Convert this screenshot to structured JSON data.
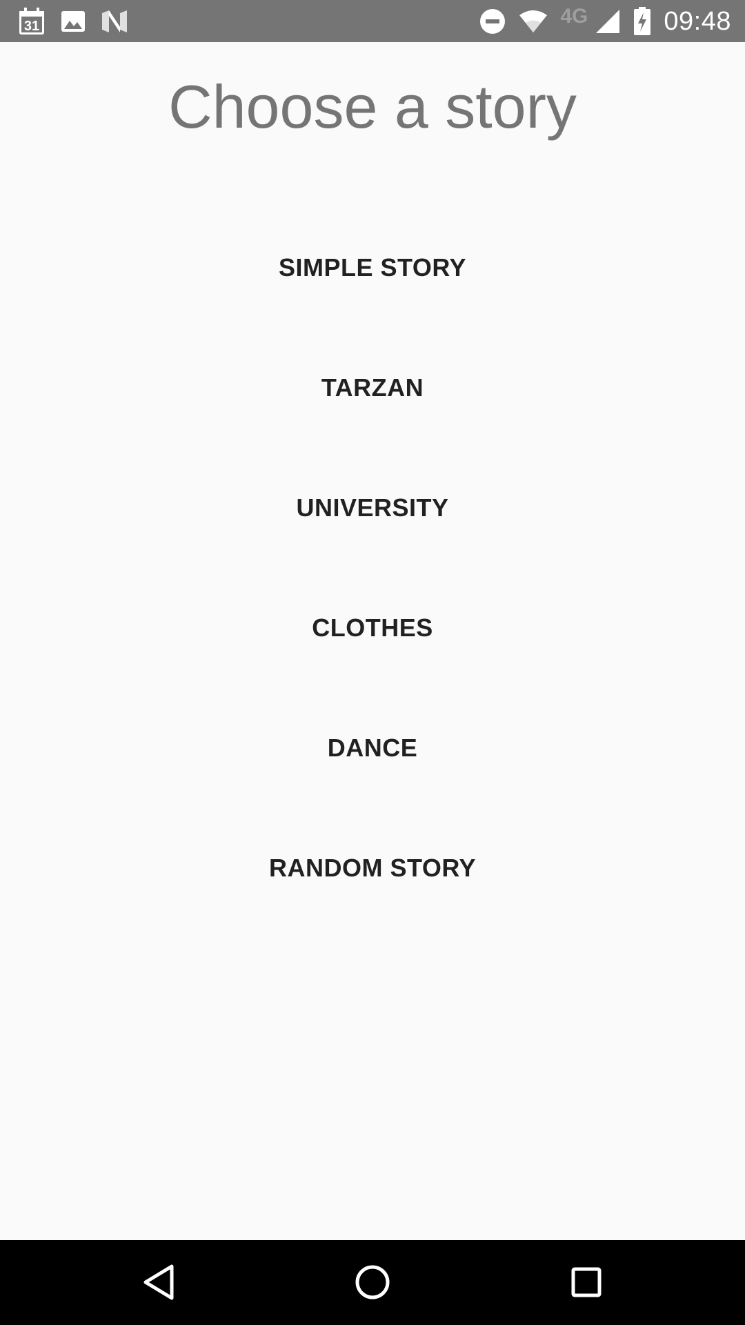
{
  "status_bar": {
    "left_icons": [
      "calendar-icon",
      "image-icon",
      "app-n-icon"
    ],
    "calendar_day": "31",
    "right_icons": [
      "do-not-disturb-icon",
      "wifi-icon",
      "cell-signal-icon",
      "battery-charging-icon"
    ],
    "network_type": "4G",
    "time": "09:48"
  },
  "main": {
    "title": "Choose a story",
    "stories": [
      {
        "label": "SIMPLE STORY"
      },
      {
        "label": "TARZAN"
      },
      {
        "label": "UNIVERSITY"
      },
      {
        "label": "CLOTHES"
      },
      {
        "label": "DANCE"
      },
      {
        "label": "RANDOM STORY"
      }
    ]
  },
  "nav_bar": {
    "buttons": [
      "back-icon",
      "home-icon",
      "recents-icon"
    ]
  },
  "colors": {
    "status_bar": "#757575",
    "background": "#fafafa",
    "title_text": "#757575",
    "button_text": "#212121",
    "nav_bar": "#000000"
  }
}
